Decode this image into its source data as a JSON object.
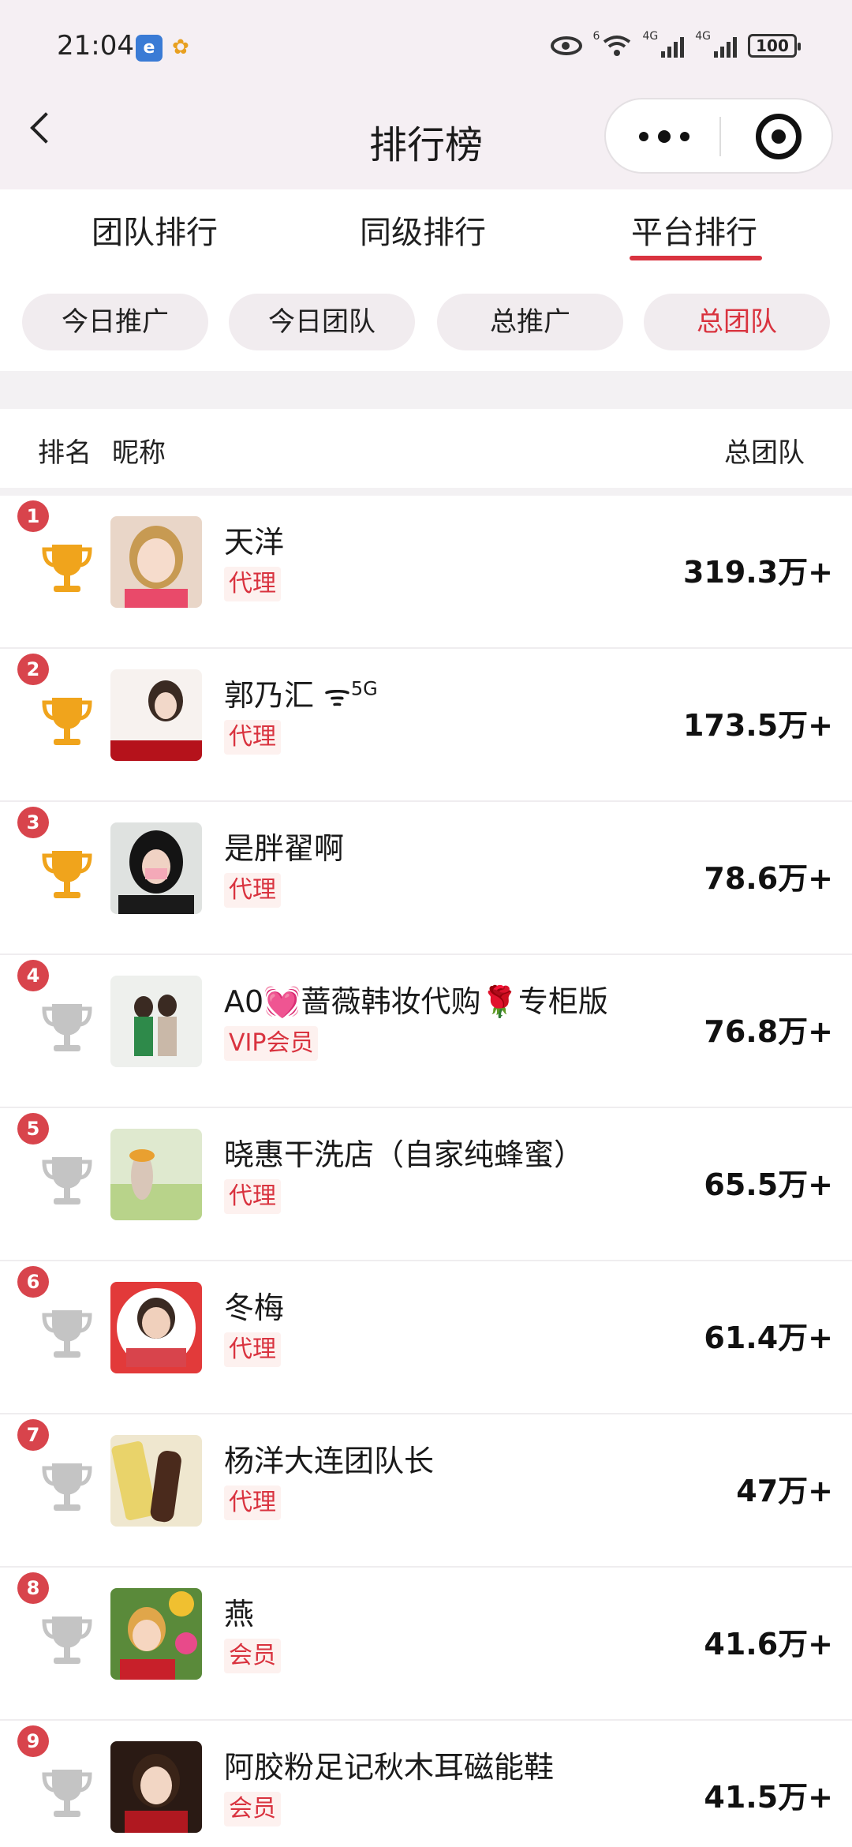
{
  "status_bar": {
    "time": "21:04",
    "app1_icon": "browser-app-icon",
    "app2_icon": "bird-app-icon",
    "net_wifi_tag": "6",
    "net1_tag": "4G",
    "net2_tag": "4G",
    "battery": "100"
  },
  "nav": {
    "title": "排行榜",
    "back_icon": "back-chevron-icon",
    "more_icon": "more-dots-icon",
    "close_icon": "target-close-icon"
  },
  "tabs": [
    {
      "label": "团队排行"
    },
    {
      "label": "同级排行"
    },
    {
      "label": "平台排行",
      "active": true
    }
  ],
  "chips": [
    {
      "label": "今日推广"
    },
    {
      "label": "今日团队"
    },
    {
      "label": "总推广"
    },
    {
      "label": "总团队",
      "active": true
    }
  ],
  "header": {
    "rank": "排名",
    "nickname": "昵称",
    "total": "总团队"
  },
  "colors": {
    "accent": "#d9333f",
    "gold_trophy": "#f0a41c",
    "silver_trophy": "#c4c4c4"
  },
  "rows": [
    {
      "rank": "1",
      "name": "天洋",
      "role": "代理",
      "value": "319.3万+",
      "trophy": "gold"
    },
    {
      "rank": "2",
      "name": "郭乃汇",
      "name_suffix": "5G",
      "role": "代理",
      "value": "173.5万+",
      "trophy": "gold"
    },
    {
      "rank": "3",
      "name": "是胖翟啊",
      "role": "代理",
      "value": "78.6万+",
      "trophy": "gold"
    },
    {
      "rank": "4",
      "name_a": "A0",
      "name_b": "蔷薇韩妆代购",
      "name_c": "专柜版",
      "role": "VIP会员",
      "value": "76.8万+",
      "trophy": "silver"
    },
    {
      "rank": "5",
      "name": "晓惠干洗店（自家纯蜂蜜）",
      "role": "代理",
      "value": "65.5万+",
      "trophy": "silver"
    },
    {
      "rank": "6",
      "name": "冬梅",
      "role": "代理",
      "value": "61.4万+",
      "trophy": "silver"
    },
    {
      "rank": "7",
      "name": "杨洋大连团队长",
      "role": "代理",
      "value": "47万+",
      "trophy": "silver"
    },
    {
      "rank": "8",
      "name": "燕",
      "role": "会员",
      "value": "41.6万+",
      "trophy": "silver"
    },
    {
      "rank": "9",
      "name": "阿胶粉足记秋木耳磁能鞋",
      "role": "会员",
      "value": "41.5万+",
      "trophy": "silver"
    }
  ]
}
